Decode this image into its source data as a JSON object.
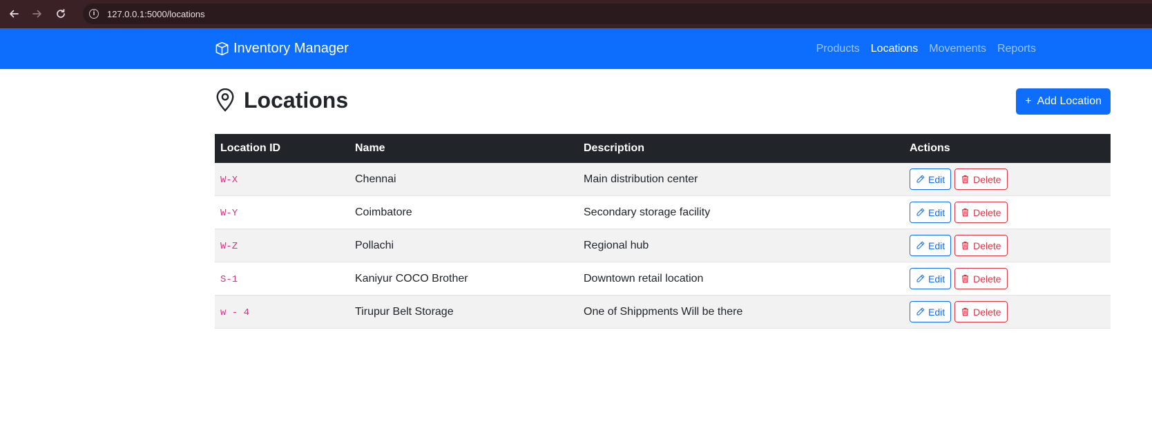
{
  "browser": {
    "url": "127.0.0.1:5000/locations"
  },
  "navbar": {
    "brand": "Inventory Manager",
    "brand_icon": "box-icon",
    "links": [
      {
        "label": "Products",
        "active": false
      },
      {
        "label": "Locations",
        "active": true
      },
      {
        "label": "Movements",
        "active": false
      },
      {
        "label": "Reports",
        "active": false
      }
    ],
    "color": "#0d6efd"
  },
  "page": {
    "title": "Locations",
    "title_icon": "geo-pin-icon",
    "add_button": {
      "icon": "+",
      "label": "Add Location"
    }
  },
  "table": {
    "headers": [
      "Location ID",
      "Name",
      "Description",
      "Actions"
    ],
    "rows": [
      {
        "id": "W-X",
        "name": "Chennai",
        "description": "Main distribution center"
      },
      {
        "id": "W-Y",
        "name": "Coimbatore",
        "description": "Secondary storage facility"
      },
      {
        "id": "W-Z",
        "name": "Pollachi",
        "description": "Regional hub"
      },
      {
        "id": "S-1",
        "name": "Kaniyur COCO Brother",
        "description": "Downtown retail location"
      },
      {
        "id": "w - 4",
        "name": "Tirupur Belt Storage",
        "description": "One of Shippments Will be there"
      }
    ],
    "edit_label": "Edit",
    "delete_label": "Delete"
  }
}
